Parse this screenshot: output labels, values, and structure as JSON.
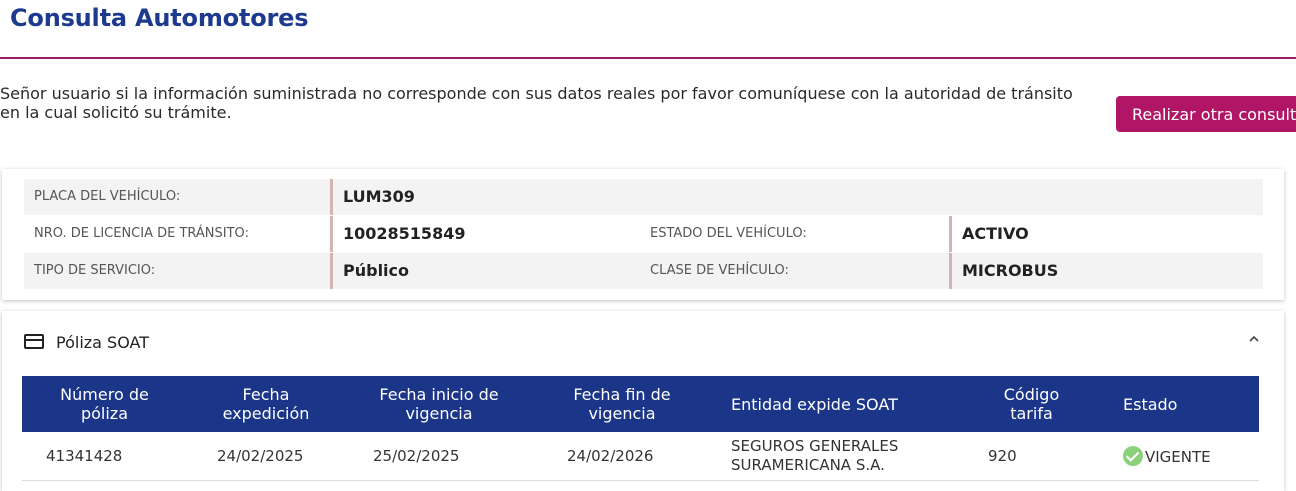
{
  "page": {
    "title": "Consulta Automotores"
  },
  "notice": {
    "line1": "Señor usuario si la información suministrada no corresponde con sus datos reales por favor comuníquese con la autoridad de tránsito",
    "line2": "en la cual solicitó su trámite."
  },
  "actions": {
    "new_query_label": "Realizar otra consulta"
  },
  "vehicle": {
    "plate_label": "PLACA DEL VEHÍCULO:",
    "plate_value": "LUM309",
    "license_label": "NRO. DE LICENCIA DE TRÁNSITO:",
    "license_value": "10028515849",
    "status_label": "ESTADO DEL VEHÍCULO:",
    "status_value": "ACTIVO",
    "service_label": "TIPO DE SERVICIO:",
    "service_value": "Público",
    "class_label": "CLASE DE VEHÍCULO:",
    "class_value": "MICROBUS"
  },
  "soat": {
    "section_title": "Póliza SOAT",
    "icon": "credit-card-icon",
    "headers": {
      "policy_number": [
        "Número de",
        "póliza"
      ],
      "issue_date": [
        "Fecha",
        "expedición"
      ],
      "start_date": [
        "Fecha inicio de",
        "vigencia"
      ],
      "end_date": [
        "Fecha fin de",
        "vigencia"
      ],
      "entity": [
        "Entidad expide SOAT"
      ],
      "rate_code": [
        "Código",
        "tarifa"
      ],
      "status": [
        "Estado"
      ]
    },
    "rows": [
      {
        "policy_number": "41341428",
        "issue_date": "24/02/2025",
        "start_date": "25/02/2025",
        "end_date": "24/02/2026",
        "entity_line1": "SEGUROS GENERALES",
        "entity_line2": "SURAMERICANA S.A.",
        "rate_code": "920",
        "status": "VIGENTE"
      }
    ]
  },
  "colors": {
    "title_blue": "#1d3a8f",
    "accent_magenta": "#b01566",
    "table_header_blue": "#1b3588",
    "status_green": "#8bd07a"
  }
}
